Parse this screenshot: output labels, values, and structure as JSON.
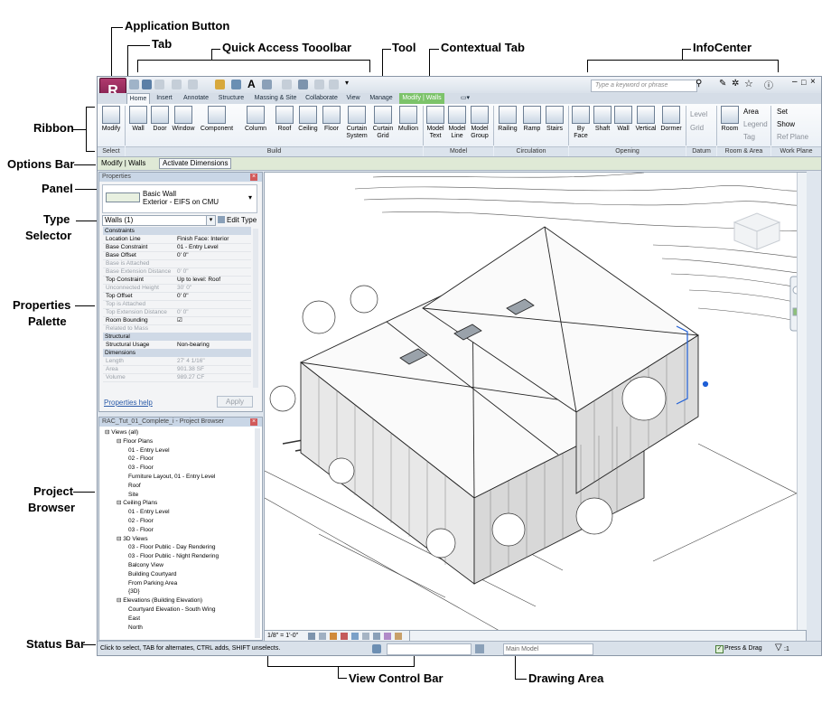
{
  "callouts": {
    "application_button": "Application Button",
    "tab": "Tab",
    "quick_access_toolbar": "Quick Access Tooolbar",
    "tool": "Tool",
    "contextual_tab": "Contextual Tab",
    "infocenter": "InfoCenter",
    "ribbon": "Ribbon",
    "options_bar": "Options Bar",
    "panel": "Panel",
    "type_selector_line1": "Type",
    "type_selector_line2": "Selector",
    "properties_palette_line1": "Properties",
    "properties_palette_line2": "Palette",
    "project_browser_line1": "Project",
    "project_browser_line2": "Browser",
    "status_bar": "Status Bar",
    "view_control_bar": "View Control Bar",
    "drawing_area": "Drawing Area"
  },
  "app": {
    "logo_letter": "R",
    "search_placeholder": "Type a keyword or phrase"
  },
  "tabs": [
    "Home",
    "Insert",
    "Annotate",
    "Structure",
    "Massing & Site",
    "Collaborate",
    "View",
    "Manage",
    "Modify | Walls"
  ],
  "ribbon": {
    "select": {
      "items": [
        "Modify"
      ],
      "panel": "Select"
    },
    "build": {
      "items": [
        "Wall",
        "Door",
        "Window",
        "Component",
        "Column",
        "Roof",
        "Ceiling",
        "Floor",
        "Curtain System",
        "Curtain Grid",
        "Mullion"
      ],
      "panel": "Build"
    },
    "model": {
      "items": [
        "Model Text",
        "Model Line",
        "Model Group"
      ],
      "panel": "Model"
    },
    "circulation": {
      "items": [
        "Railing",
        "Ramp",
        "Stairs"
      ],
      "panel": "Circulation"
    },
    "opening": {
      "items": [
        "By Face",
        "Shaft",
        "Wall",
        "Vertical",
        "Dormer"
      ],
      "panel": "Opening"
    },
    "datum": {
      "items": [
        "Level",
        "Grid"
      ],
      "panel": "Datum"
    },
    "room_area": {
      "items": [
        "Room",
        "Area",
        "Legend",
        "Tag"
      ],
      "panel": "Room & Area"
    },
    "work_plane": {
      "items": [
        "Set",
        "Show",
        "Ref Plane"
      ],
      "panel": "Work Plane"
    }
  },
  "options_bar": {
    "context": "Modify | Walls",
    "button": "Activate Dimensions"
  },
  "properties": {
    "title": "Properties",
    "type_name": "Basic Wall",
    "type_sub": "Exterior - EIFS on CMU",
    "instance_selector": "Walls (1)",
    "edit_type": "Edit Type",
    "groups": [
      {
        "name": "Constraints",
        "rows": [
          {
            "k": "Location Line",
            "v": "Finish Face: Interior",
            "grey": false
          },
          {
            "k": "Base Constraint",
            "v": "01 - Entry Level",
            "grey": false
          },
          {
            "k": "Base Offset",
            "v": "0' 0\"",
            "grey": false
          },
          {
            "k": "Base is Attached",
            "v": "",
            "grey": true
          },
          {
            "k": "Base Extension Distance",
            "v": "0' 0\"",
            "grey": true
          },
          {
            "k": "Top Constraint",
            "v": "Up to level: Roof",
            "grey": false
          },
          {
            "k": "Unconnected Height",
            "v": "30' 0\"",
            "grey": true
          },
          {
            "k": "Top Offset",
            "v": "0' 0\"",
            "grey": false
          },
          {
            "k": "Top is Attached",
            "v": "",
            "grey": true
          },
          {
            "k": "Top Extension Distance",
            "v": "0' 0\"",
            "grey": true
          },
          {
            "k": "Room Bounding",
            "v": "☑",
            "grey": false
          },
          {
            "k": "Related to Mass",
            "v": "",
            "grey": true
          }
        ]
      },
      {
        "name": "Structural",
        "rows": [
          {
            "k": "Structural Usage",
            "v": "Non-bearing",
            "grey": false
          }
        ]
      },
      {
        "name": "Dimensions",
        "rows": [
          {
            "k": "Length",
            "v": "27' 4 1/16\"",
            "grey": true
          },
          {
            "k": "Area",
            "v": "901.38 SF",
            "grey": true
          },
          {
            "k": "Volume",
            "v": "989.27 CF",
            "grey": true
          }
        ]
      }
    ],
    "help": "Properties help",
    "apply": "Apply"
  },
  "browser": {
    "title": "RAC_Tut_01_Complete_i - Project Browser",
    "tree": [
      {
        "t": "Views (all)",
        "d": 0
      },
      {
        "t": "Floor Plans",
        "d": 1
      },
      {
        "t": "01 - Entry Level",
        "d": 2
      },
      {
        "t": "02 - Floor",
        "d": 2
      },
      {
        "t": "03 - Floor",
        "d": 2
      },
      {
        "t": "Furniture Layout,  01 - Entry Level",
        "d": 2
      },
      {
        "t": "Roof",
        "d": 2
      },
      {
        "t": "Site",
        "d": 2
      },
      {
        "t": "Ceiling Plans",
        "d": 1
      },
      {
        "t": "01 - Entry Level",
        "d": 2
      },
      {
        "t": "02 - Floor",
        "d": 2
      },
      {
        "t": "03 - Floor",
        "d": 2
      },
      {
        "t": "3D Views",
        "d": 1
      },
      {
        "t": "03 - Floor Public - Day Rendering",
        "d": 2
      },
      {
        "t": "03 - Floor Public - Night Rendering",
        "d": 2
      },
      {
        "t": "Balcony View",
        "d": 2
      },
      {
        "t": "Building Courtyard",
        "d": 2
      },
      {
        "t": "From Parking Area",
        "d": 2
      },
      {
        "t": "{3D}",
        "d": 2
      },
      {
        "t": "Elevations (Building Elevation)",
        "d": 1
      },
      {
        "t": "Courtyard Elevation - South Wing",
        "d": 2
      },
      {
        "t": "East",
        "d": 2
      },
      {
        "t": "North",
        "d": 2
      }
    ]
  },
  "view_control": {
    "scale": "1/8\" = 1'-0\""
  },
  "status": {
    "text": "Click to select, TAB for alternates, CTRL adds, SHIFT unselects.",
    "workset": "Main Model",
    "press_drag": "Press & Drag",
    "filter_count": ":1"
  },
  "colors": {
    "app_button": "#8c1d52",
    "contextual_tab": "#7cc36a",
    "ribbon_bg": "#eef2f6"
  }
}
